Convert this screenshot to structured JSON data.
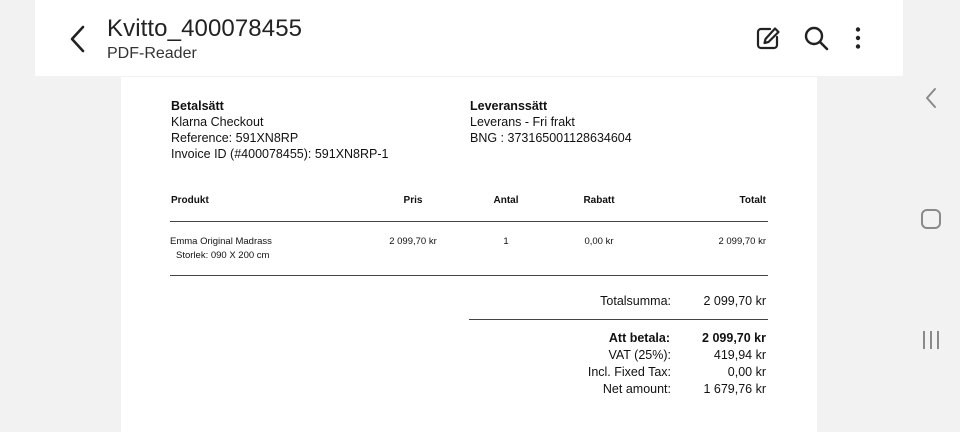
{
  "appbar": {
    "title": "Kvitto_400078455",
    "subtitle": "PDF-Reader",
    "icons": [
      "back-arrow-icon",
      "edit-icon",
      "search-icon",
      "more-vert-icon"
    ]
  },
  "document": {
    "payment": {
      "heading": "Betalsätt",
      "line1": "Klarna Checkout",
      "line2": "Reference: 591XN8RP",
      "line3": "Invoice ID (#400078455): 591XN8RP-1"
    },
    "delivery": {
      "heading": "Leveranssätt",
      "line1": "Leverans - Fri frakt",
      "line2": "BNG : 373165001128634604"
    },
    "table": {
      "headers": {
        "product": "Produkt",
        "price": "Pris",
        "qty": "Antal",
        "discount": "Rabatt",
        "total": "Totalt"
      },
      "rows": [
        {
          "product": "Emma Original Madrass",
          "detail": "Storlek: 090 X 200 cm",
          "price": "2 099,70 kr",
          "qty": "1",
          "discount": "0,00 kr",
          "total": "2 099,70 kr"
        }
      ]
    },
    "summary": {
      "subtotal_label": "Totalsumma:",
      "subtotal_value": "2 099,70 kr",
      "pay_label": "Att betala:",
      "pay_value": "2 099,70 kr",
      "vat_label": "VAT (25%):",
      "vat_value": "419,94 kr",
      "tax_label": "Incl. Fixed Tax:",
      "tax_value": "0,00 kr",
      "net_label": "Net amount:",
      "net_value": "1 679,76 kr"
    }
  },
  "system_nav": {
    "icons": [
      "back-chevron-icon",
      "home-icon",
      "recents-icon"
    ]
  }
}
